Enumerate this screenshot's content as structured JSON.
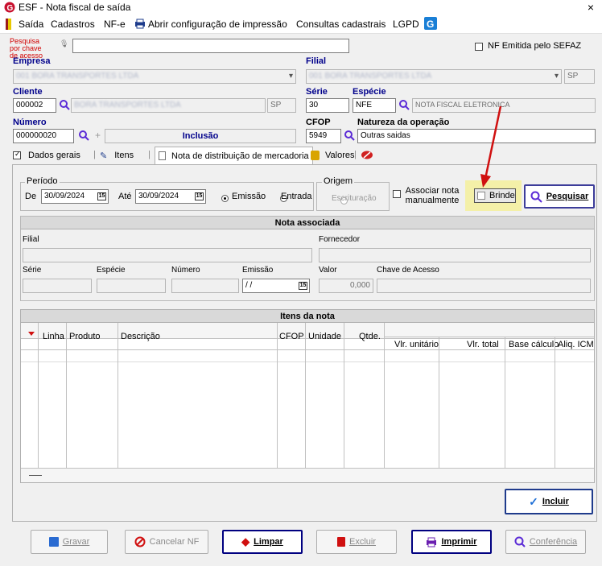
{
  "window": {
    "title": "ESF - Nota fiscal de saída",
    "close": "×"
  },
  "menu": {
    "saida": "Saída",
    "cadastros": "Cadastros",
    "nfe": "NF-e",
    "abrir_impressao": "Abrir configuração de impressão",
    "consultas": "Consultas cadastrais",
    "lgpd": "LGPD"
  },
  "search": {
    "label": "Pesquisa por chave de acesso",
    "value": "",
    "nf_emitida_label": "NF Emitida pelo SEFAZ"
  },
  "empresa": {
    "label": "Empresa",
    "value": "001 BORA TRANSPORTES LTDA"
  },
  "filial": {
    "label": "Filial",
    "value": "001 BORA TRANSPORTES LTDA",
    "uf": "SP"
  },
  "cliente": {
    "label": "Cliente",
    "code": "000002",
    "name": "BORA TRANSPORTES LTDA",
    "uf": "SP"
  },
  "serie": {
    "label": "Série",
    "value": "30"
  },
  "especie": {
    "label": "Espécie",
    "code": "NFE",
    "description": "NOTA FISCAL ELETRONICA"
  },
  "numero": {
    "label": "Número",
    "value": "000000020",
    "status": "Inclusão"
  },
  "cfop": {
    "label": "CFOP",
    "value": "5949"
  },
  "natureza": {
    "label": "Natureza da operação",
    "value": "Outras saidas"
  },
  "tabs": [
    {
      "label": "Dados gerais",
      "icon": "checkbox-icon"
    },
    {
      "label": "Itens",
      "icon": "pencil-icon"
    },
    {
      "label": "Nota de distribuição de mercadoria",
      "icon": "document-icon"
    },
    {
      "label": "Valores",
      "icon": "coins-icon"
    }
  ],
  "periodo": {
    "title": "Período",
    "de_label": "De",
    "de_value": "30/09/2024",
    "ate_label": "Até",
    "ate_value": "30/09/2024",
    "emissao_label": "Emissão",
    "entrada_label": "Entrada",
    "selected": "Emissão"
  },
  "origem": {
    "title": "Origem",
    "escrituracao_label": "Escrituração"
  },
  "associar_label": "Associar nota manualmente",
  "brinde_label": "Brinde",
  "pesquisar_label": "Pesquisar",
  "nota_associada": {
    "title": "Nota associada",
    "filial_label": "Filial",
    "fornecedor_label": "Fornecedor",
    "serie_label": "Série",
    "especie_label": "Espécie",
    "numero_label": "Número",
    "emissao_label": "Emissão",
    "emissao_value": " / /",
    "valor_label": "Valor",
    "valor_value": "0,000",
    "chave_label": "Chave de Acesso"
  },
  "itens": {
    "title": "Itens da nota",
    "columns": [
      "Linha",
      "Produto",
      "Descrição",
      "CFOP",
      "Unidade",
      "Qtde.",
      "Vlr. unitário",
      "Vlr. total",
      "Base cálculo",
      "Aliq. ICM"
    ]
  },
  "incluir_label": "Incluir",
  "footer": {
    "gravar": "Gravar",
    "cancelar": "Cancelar NF",
    "limpar": "Limpar",
    "excluir": "Excluir",
    "imprimir": "Imprimir",
    "conferencia": "Conferência"
  },
  "colors": {
    "accent": "#5b2bd6",
    "highlight": "#f4f0a8",
    "arrow": "#d01010"
  }
}
